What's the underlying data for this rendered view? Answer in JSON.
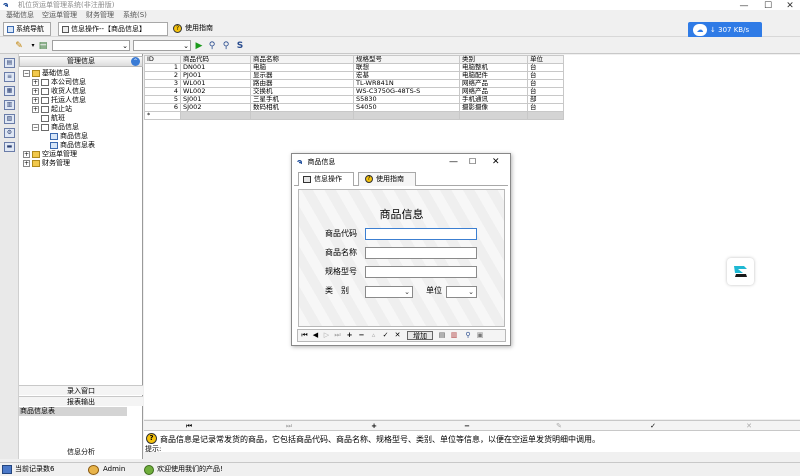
{
  "window": {
    "title": "机位货运单管理系统(非注册版)",
    "min": "—",
    "max": "☐",
    "close": "✕"
  },
  "menu": [
    "基础信息",
    "空运单管理",
    "财务管理",
    "系统(S)"
  ],
  "toolbar": {
    "nav_tab": "系统导航",
    "op_tab": "信息操作--【商品信息】",
    "guide_tab": "使用指南"
  },
  "speed": "307 KB/s",
  "nav": {
    "header": "管理信息",
    "tree": [
      {
        "label": "基础信息",
        "level": 0,
        "exp": "−",
        "icon": "folder"
      },
      {
        "label": "本公司信息",
        "level": 1,
        "exp": "+",
        "icon": "doc"
      },
      {
        "label": "收货人信息",
        "level": 1,
        "exp": "+",
        "icon": "doc"
      },
      {
        "label": "托运人信息",
        "level": 1,
        "exp": "+",
        "icon": "doc"
      },
      {
        "label": "起止站",
        "level": 1,
        "exp": "+",
        "icon": "doc"
      },
      {
        "label": "航班",
        "level": 1,
        "exp": "",
        "icon": "doc"
      },
      {
        "label": "商品信息",
        "level": 1,
        "exp": "−",
        "icon": "doc"
      },
      {
        "label": "商品信息",
        "level": 2,
        "exp": "",
        "icon": "form"
      },
      {
        "label": "商品信息表",
        "level": 2,
        "exp": "",
        "icon": "form"
      },
      {
        "label": "空运单管理",
        "level": 0,
        "exp": "+",
        "icon": "folder"
      },
      {
        "label": "财务管理",
        "level": 0,
        "exp": "+",
        "icon": "folder"
      }
    ],
    "bottom": {
      "entry": "录入窗口",
      "report": "报表输出",
      "report_item": "商品信息表",
      "analysis": "信息分析"
    }
  },
  "grid": {
    "columns": [
      "ID",
      "商品代码",
      "商品名称",
      "规格型号",
      "类别",
      "单位"
    ],
    "rows": [
      [
        "1",
        "DN001",
        "电脑",
        "联想",
        "电脑整机",
        "台"
      ],
      [
        "2",
        "PJ001",
        "显示器",
        "宏基",
        "电脑配件",
        "台"
      ],
      [
        "3",
        "WL001",
        "路由器",
        "TL-WR841N",
        "网络产品",
        "台"
      ],
      [
        "4",
        "WL002",
        "交换机",
        "WS-C3750G-48TS-S",
        "网络产品",
        "台"
      ],
      [
        "5",
        "SJ001",
        "三星手机",
        "S5830",
        "手机通讯",
        "部"
      ],
      [
        "6",
        "SJ002",
        "数码相机",
        "S4050",
        "摄影摄像",
        "台"
      ]
    ]
  },
  "dialog": {
    "title": "商品信息",
    "tab_op": "信息操作",
    "tab_guide": "使用指南",
    "heading": "商品信息",
    "fields": {
      "code": "商品代码",
      "name": "商品名称",
      "spec": "规格型号",
      "category": "类　别",
      "unit": "单位"
    },
    "add_btn": "增加"
  },
  "info_text": "商品信息是记录常发货的商品，它包括商品代码、商品名称、规格型号、类别、单位等信息，以便在空运单发货明细中调用。",
  "tip_label": "提示:",
  "status": {
    "count_label": "当前记录数",
    "count": "6",
    "user": "Admin",
    "welcome": "欢迎使用我们的产品!"
  },
  "colors": {
    "accent": "#2f7be6",
    "selection": "#d4d4d4"
  }
}
